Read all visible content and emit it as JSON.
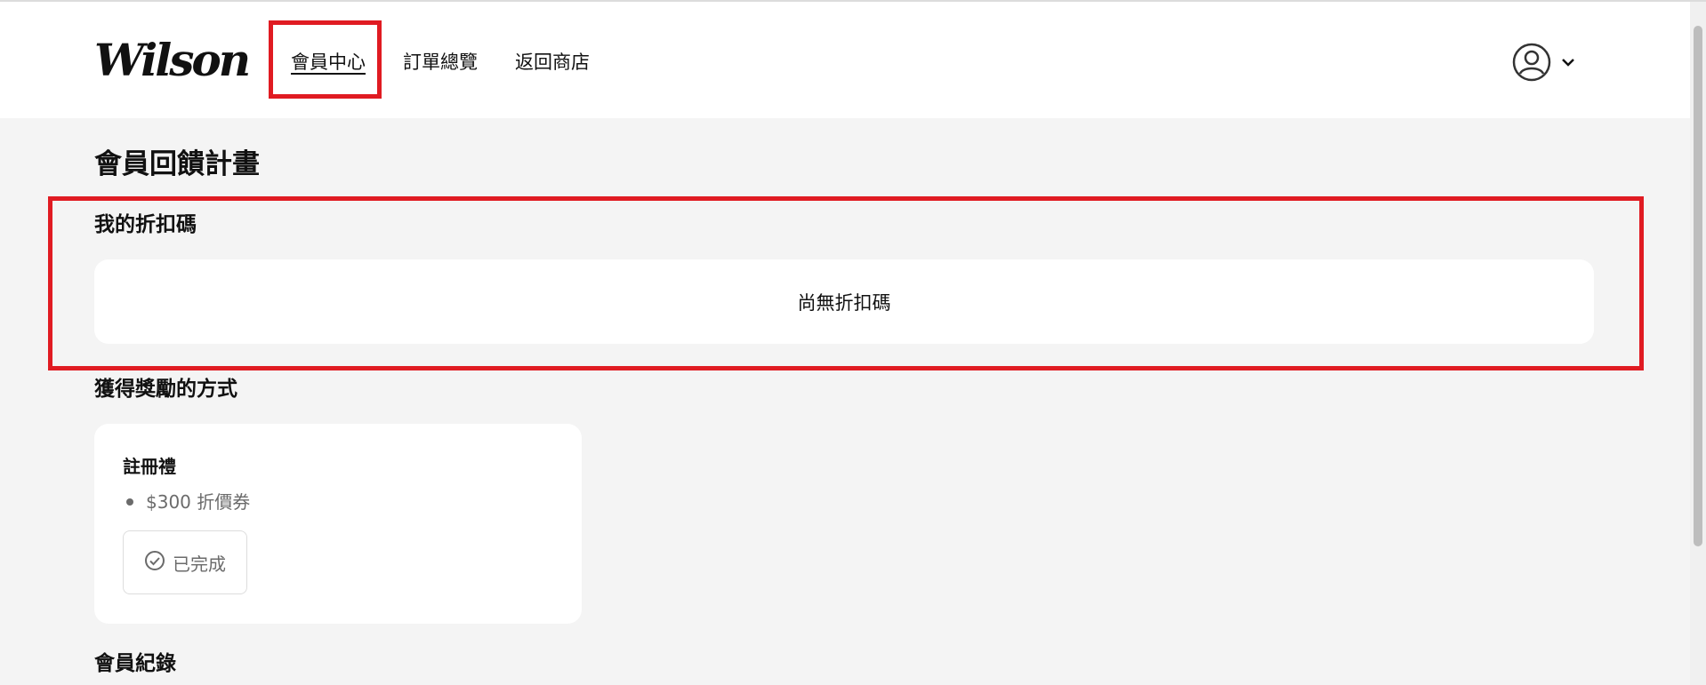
{
  "header": {
    "logo_text": "Wilson",
    "nav": {
      "member_center": "會員中心",
      "order_overview": "訂單總覽",
      "back_to_store": "返回商店"
    }
  },
  "main": {
    "page_title": "會員回饋計畫",
    "coupons": {
      "title": "我的折扣碼",
      "empty_text": "尚無折扣碼"
    },
    "earn": {
      "title": "獲得獎勵的方式",
      "card": {
        "title": "註冊禮",
        "bullet": "$300 折價券",
        "status": "已完成"
      }
    },
    "records": {
      "title": "會員紀錄"
    }
  },
  "colors": {
    "highlight": "#e01b22",
    "background": "#f4f4f4",
    "card": "#ffffff",
    "muted_text": "#6b6b6b"
  },
  "icons": [
    "user-avatar-icon",
    "chevron-down-icon",
    "check-circle-icon"
  ]
}
